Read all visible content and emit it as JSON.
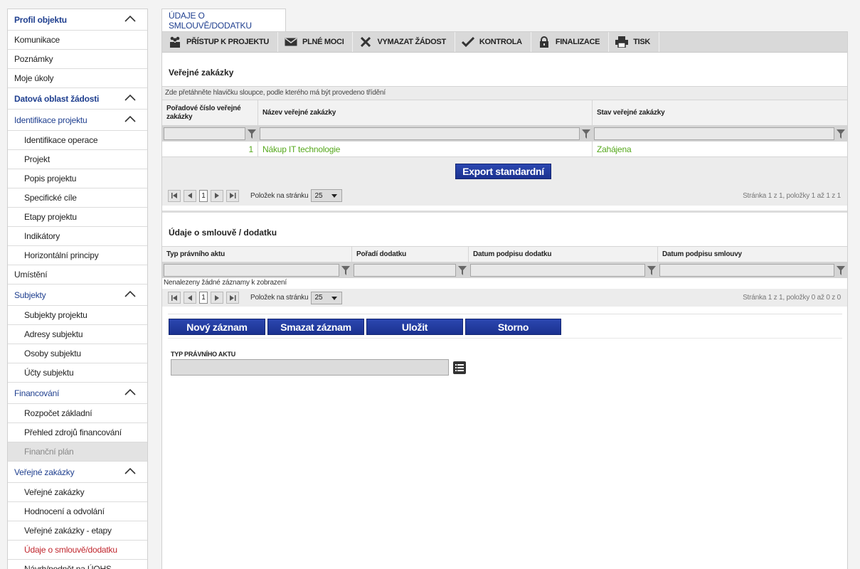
{
  "sidebar": {
    "items": [
      {
        "label": "Profil objektu",
        "kind": "section-bold",
        "chevron": true
      },
      {
        "label": "Komunikace",
        "kind": "item"
      },
      {
        "label": "Poznámky",
        "kind": "item"
      },
      {
        "label": "Moje úkoly",
        "kind": "item"
      },
      {
        "label": "Datová oblast žádosti",
        "kind": "section-bold",
        "chevron": true
      },
      {
        "label": "Identifikace projektu",
        "kind": "section",
        "chevron": true
      },
      {
        "label": "Identifikace operace",
        "kind": "sub"
      },
      {
        "label": "Projekt",
        "kind": "sub"
      },
      {
        "label": "Popis projektu",
        "kind": "sub"
      },
      {
        "label": "Specifické cíle",
        "kind": "sub"
      },
      {
        "label": "Etapy projektu",
        "kind": "sub"
      },
      {
        "label": "Indikátory",
        "kind": "sub"
      },
      {
        "label": "Horizontální principy",
        "kind": "sub"
      },
      {
        "label": "Umístění",
        "kind": "item"
      },
      {
        "label": "Subjekty",
        "kind": "section",
        "chevron": true
      },
      {
        "label": "Subjekty projektu",
        "kind": "sub"
      },
      {
        "label": "Adresy subjektu",
        "kind": "sub"
      },
      {
        "label": "Osoby subjektu",
        "kind": "sub"
      },
      {
        "label": "Účty subjektu",
        "kind": "sub"
      },
      {
        "label": "Financování",
        "kind": "section",
        "chevron": true
      },
      {
        "label": "Rozpočet základní",
        "kind": "sub"
      },
      {
        "label": "Přehled zdrojů financování",
        "kind": "sub"
      },
      {
        "label": "Finanční plán",
        "kind": "sub-disabled"
      },
      {
        "label": "Veřejné zakázky",
        "kind": "section",
        "chevron": true
      },
      {
        "label": "Veřejné zakázky",
        "kind": "sub"
      },
      {
        "label": "Hodnocení a odvolání",
        "kind": "sub"
      },
      {
        "label": "Veřejné zakázky - etapy",
        "kind": "sub"
      },
      {
        "label": "Údaje o smlouvě/dodatku",
        "kind": "sub-active"
      },
      {
        "label": "Návrh/podnět na ÚOHS",
        "kind": "sub"
      }
    ]
  },
  "tab": {
    "label": "ÚDAJE O SMLOUVĚ/DODATKU"
  },
  "toolbar": {
    "buttons": [
      {
        "label": "PŘÍSTUP K PROJEKTU",
        "icon": "people-icon"
      },
      {
        "label": "PLNÉ MOCI",
        "icon": "envelope-icon"
      },
      {
        "label": "VYMAZAT ŽÁDOST",
        "icon": "x-icon"
      },
      {
        "label": "KONTROLA",
        "icon": "check-icon"
      },
      {
        "label": "FINALIZACE",
        "icon": "lock-icon"
      },
      {
        "label": "TISK",
        "icon": "printer-icon"
      }
    ]
  },
  "grid1": {
    "title": "Veřejné zakázky",
    "group_hint": "Zde přetáhněte hlavičku sloupce, podle kterého má být provedeno třídění",
    "columns": [
      "Pořadové číslo veřejné zakázky",
      "Název veřejné zakázky",
      "Stav veřejné zakázky"
    ],
    "rows": [
      {
        "cells": [
          "1",
          "Nákup IT technologie",
          "Zahájena"
        ]
      }
    ],
    "export_label": "Export standardní",
    "pager": {
      "page": "1",
      "per_page_label": "Položek na stránku",
      "per_page": "25",
      "info": "Stránka 1 z 1, položky 1 až 1 z 1"
    }
  },
  "grid2": {
    "title": "Údaje o smlouvě / dodatku",
    "columns": [
      "Typ právního aktu",
      "Pořadí dodatku",
      "Datum podpisu dodatku",
      "Datum podpisu smlouvy"
    ],
    "empty_text": "Nenalezeny žádné záznamy k zobrazení",
    "pager": {
      "page": "1",
      "per_page_label": "Položek na stránku",
      "per_page": "25",
      "info": "Stránka 1 z 1, položky 0 až 0 z 0"
    }
  },
  "actions": {
    "new": "Nový záznam",
    "delete": "Smazat záznam",
    "save": "Uložit",
    "cancel": "Storno"
  },
  "form": {
    "type_label": "TYP PRÁVNÍHO AKTU",
    "type_value": ""
  },
  "colors": {
    "accent": "#1f3f8f",
    "active": "#c0262d",
    "link_green": "#55a81c",
    "button_blue": "#203b9e"
  }
}
